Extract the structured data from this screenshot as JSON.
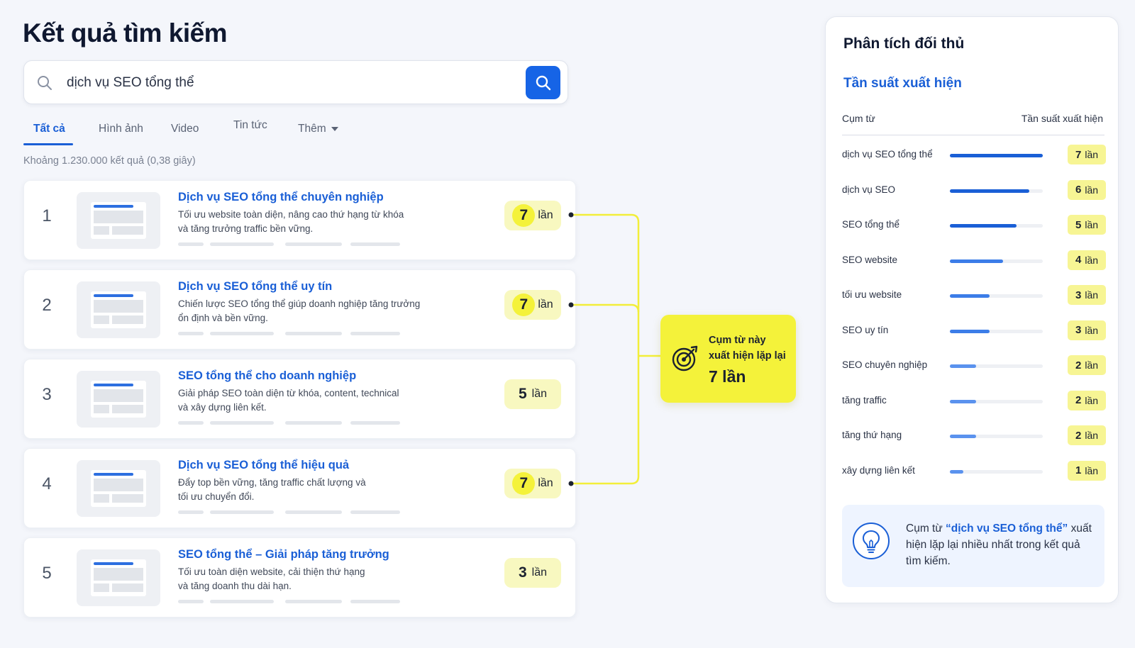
{
  "page": {
    "title": "Kết quả tìm kiếm"
  },
  "search": {
    "query": "dịch vụ SEO tổng thể"
  },
  "tabs": [
    {
      "label": "Tất cả"
    },
    {
      "label": "Hình ảnh"
    },
    {
      "label": "Video"
    },
    {
      "label": "Tin tức"
    },
    {
      "label": "Thêm"
    }
  ],
  "result_stats": "Khoảng 1.230.000 kết quả (0,38 giây)",
  "count_unit": "lần",
  "results": [
    {
      "rank": "1",
      "title": "Dịch vụ SEO tổng thể chuyên nghiệp",
      "desc_1": "Tối ưu website toàn diện, nâng cao thứ hạng từ khóa",
      "desc_2": "và tăng trưởng traffic bền vững.",
      "count": "7"
    },
    {
      "rank": "2",
      "title": "Dịch vụ SEO tổng thể uy tín",
      "desc_1": "Chiến lược SEO tổng thể giúp doanh nghiệp tăng trưởng",
      "desc_2": "ổn định và bền vững.",
      "count": "7"
    },
    {
      "rank": "3",
      "title": "SEO tổng thể cho doanh nghiệp",
      "desc_1": "Giải pháp SEO toàn diện từ khóa, content, technical",
      "desc_2": "và xây dựng liên kết.",
      "count": "5"
    },
    {
      "rank": "4",
      "title": "Dịch vụ SEO tổng thể hiệu quả",
      "desc_1": "Đẩy top bền vững, tăng traffic chất lượng và",
      "desc_2": "tối ưu chuyển đổi.",
      "count": "7"
    },
    {
      "rank": "5",
      "title": "SEO tổng thể – Giải pháp tăng trưởng",
      "desc_1": "Tối ưu toàn diện website, cải thiện thứ hạng",
      "desc_2": "và tăng doanh thu dài hạn.",
      "count": "3"
    }
  ],
  "callout": {
    "line1": "Cụm từ này",
    "line2": "xuất hiện lặp lại",
    "count": "7 lần"
  },
  "panel": {
    "title": "Phân tích đối thủ",
    "subtitle": "Tần suất xuất hiện",
    "col_phrase": "Cụm từ",
    "col_freq": "Tần suất xuất hiện",
    "rows": [
      {
        "phrase": "dịch vụ SEO tổng thể",
        "count": "7",
        "value": 7
      },
      {
        "phrase": "dịch vụ SEO",
        "count": "6",
        "value": 6
      },
      {
        "phrase": "SEO tổng thể",
        "count": "5",
        "value": 5
      },
      {
        "phrase": "SEO website",
        "count": "4",
        "value": 4
      },
      {
        "phrase": "tối ưu website",
        "count": "3",
        "value": 3
      },
      {
        "phrase": "SEO uy tín",
        "count": "3",
        "value": 3
      },
      {
        "phrase": "SEO chuyên nghiệp",
        "count": "2",
        "value": 2
      },
      {
        "phrase": "tăng traffic",
        "count": "2",
        "value": 2
      },
      {
        "phrase": "tăng thứ hạng",
        "count": "2",
        "value": 2
      },
      {
        "phrase": "xây dựng liên kết",
        "count": "1",
        "value": 1
      }
    ],
    "insight_prefix": "Cụm từ ",
    "insight_quote": "“dịch vụ SEO tổng thể”",
    "insight_rest": " xuất hiện lặp lại nhiều nhất trong kết quả tìm kiếm."
  },
  "colors": {
    "accent": "#1a5fd6",
    "highlight": "#f4f23a",
    "badge": "#f8f8c0"
  }
}
